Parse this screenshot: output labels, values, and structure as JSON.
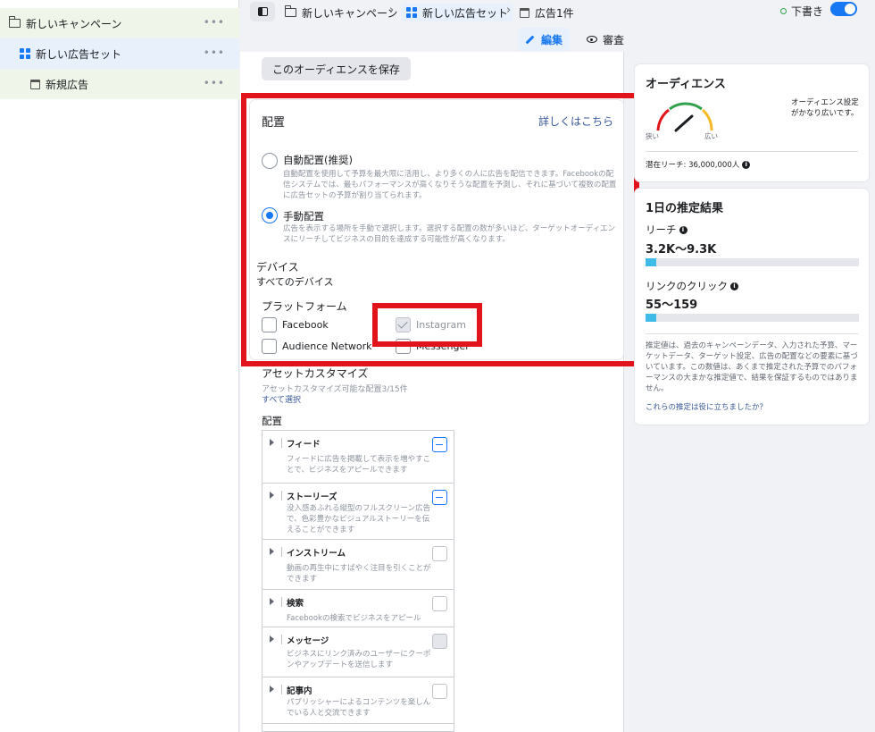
{
  "sidebar": {
    "campaign": "新しいキャンペーン",
    "adset": "新しい広告セット",
    "ad": "新規広告",
    "more": "•••"
  },
  "topbar": {
    "crumbs": [
      "新しいキャンペーン",
      "新しい広告セット",
      "広告1件"
    ],
    "sep": "›",
    "draft": "下書き",
    "edit": "編集",
    "review": "審査"
  },
  "main": {
    "save_audience": "このオーディエンスを保存",
    "placement": {
      "title": "配置",
      "learn_more": "詳しくはこちら",
      "auto_title": "自動配置(推奨)",
      "auto_desc": "自動配置を使用して予算を最大限に活用し、より多くの人に広告を配信できます。Facebookの配信システムでは、最もパフォーマンスが高くなりそうな配置を予測し、それに基づいて複数の配置に広告セットの予算が割り当てられます。",
      "manual_title": "手動配置",
      "manual_desc": "広告を表示する場所を手動で選択します。選択する配置の数が多いほど、ターゲットオーディエンスにリーチしてビジネスの目的を達成する可能性が高くなります。",
      "devices_h": "デバイス",
      "devices_v": "すべてのデバイス",
      "platforms_h": "プラットフォーム",
      "platforms": [
        "Facebook",
        "Instagram",
        "Audience Network",
        "Messenger"
      ]
    },
    "asset": {
      "title": "アセットカスタマイズ",
      "sub": "アセットカスタマイズ可能な配置3/15件",
      "select_all": "すべて選択"
    },
    "haichi_h": "配置",
    "placements": [
      {
        "name": "フィード",
        "desc": "フィードに広告を掲載して表示を増やすことで、ビジネスをアピールできます"
      },
      {
        "name": "ストーリーズ",
        "desc": "没入感あふれる縦型のフルスクリーン広告で、色彩豊かなビジュアルストーリーを伝えることができます"
      },
      {
        "name": "インストリーム",
        "desc": "動画の再生中にすばやく注目を引くことができます"
      },
      {
        "name": "検索",
        "desc": "Facebookの検索でビジネスをアピール"
      },
      {
        "name": "メッセージ",
        "desc": "ビジネスにリンク済みのユーザーにクーポンやアップデートを送信します"
      },
      {
        "name": "記事内",
        "desc": "パブリッシャーによるコンテンツを楽しんでいる人と交流できます"
      }
    ]
  },
  "audience": {
    "title": "オーディエンス",
    "narrow": "狭い",
    "wide": "広い",
    "desc": "オーディエンス設定がかなり広いです。",
    "reach": "潜在リーチ: 36,000,000人"
  },
  "estimate": {
    "title": "1日の推定結果",
    "reach_lbl": "リーチ",
    "reach_val": "3.2K〜9.3K",
    "reach_fill": 0.05,
    "click_lbl": "リンクのクリック",
    "click_val": "55〜159",
    "click_fill": 0.05,
    "note": "推定値は、過去のキャンペーンデータ、入力された予算、マーケットデータ、ターゲット設定、広告の配置などの要素に基づいています。この数値は、あくまで推定された予算でのパフォーマンスの大まかな推定値で、結果を保証するものではありません。",
    "feedback": "これらの推定は役に立ちましたか？"
  },
  "colors": {
    "accent": "#1877f2",
    "highlight": "#e1141b",
    "bar": "#3ebbe6"
  },
  "icons": [
    "folder-icon",
    "grid-icon",
    "doc-icon",
    "panel-icon",
    "pencil-icon",
    "eye-icon",
    "info-icon"
  ]
}
